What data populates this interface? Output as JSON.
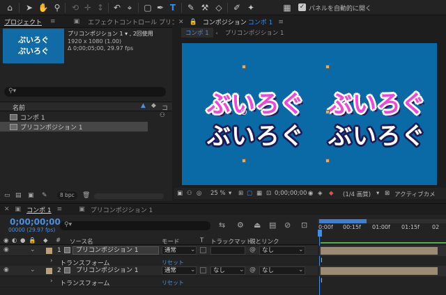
{
  "toolbar": {
    "auto_open_label": "パネルを自動的に開く"
  },
  "project_panel": {
    "tabs": [
      "プロジェクト",
      "エフェクトコントロール プリコン"
    ],
    "thumbnail_text": [
      "ぷいろぐ",
      "ぷいろぐ"
    ],
    "item_name": "プリコンポジション 1 ▾ , 2回使用",
    "item_res": "1920 x 1080 (1.00)",
    "item_duration": "Δ 0;00;05;00, 29.97 fps",
    "search_placeholder": "",
    "col_name": "名前",
    "items": [
      "コンポ 1",
      "プリコンポジション 1"
    ],
    "bpc": "8 bpc"
  },
  "viewer": {
    "tab_title": "コンポジション",
    "tab_comp": "コンポ 1",
    "sub_tabs": [
      "コンポ 1",
      "プリコンポジション 1"
    ],
    "canvas_text": [
      "ぶいろぐ",
      "ぶいろぐ",
      "ぶいろぐ",
      "ぶいろぐ"
    ],
    "zoom": "25 %",
    "timecode": "0;00;00;00",
    "resolution": "(1/4 画質)",
    "camera": "アクティブカメ"
  },
  "timeline": {
    "tabs": [
      "コンポ 1",
      "プリコンポジション 1"
    ],
    "current_time": "0;00;00;00",
    "frame_info": "00000 (29.97 fps)",
    "ruler": [
      "0:00f",
      "00:15f",
      "01:00f",
      "01:15f",
      "02"
    ],
    "headers": {
      "source": "ソース名",
      "mode": "モード",
      "t": "T",
      "trackmatte": "トラックマット",
      "parent": "親とリンク"
    },
    "layers": [
      {
        "num": "1",
        "name": "プリコンポジション 1",
        "mode": "通常",
        "matte": "",
        "parent": "なし",
        "sub": "トランスフォーム",
        "reset": "リセット"
      },
      {
        "num": "2",
        "name": "プリコンポジション 1",
        "mode": "通常",
        "matte": "なし",
        "parent": "なし",
        "sub": "トランスフォーム",
        "reset": "リセット"
      }
    ]
  }
}
